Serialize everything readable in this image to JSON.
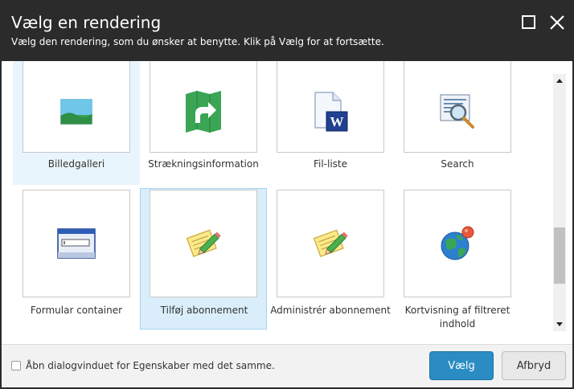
{
  "dialog": {
    "title": "Vælg en rendering",
    "subtitle": "Vælg den rendering, som du ønsker at benytte. Klik på Vælg for at fortsætte.",
    "maximize_icon": "maximize-icon",
    "close_icon": "close-icon"
  },
  "tiles": [
    {
      "label": "Billedgalleri",
      "icon": "image-gallery-icon",
      "state": "hover"
    },
    {
      "label": "Strækningsinformation",
      "icon": "route-sign-icon",
      "state": "normal"
    },
    {
      "label": "Fil-liste",
      "icon": "word-document-icon",
      "state": "normal"
    },
    {
      "label": "Search",
      "icon": "magnifier-document-icon",
      "state": "normal"
    },
    {
      "label": "Formular container",
      "icon": "form-window-icon",
      "state": "normal"
    },
    {
      "label": "Tilføj abonnement",
      "icon": "notepad-pencil-icon",
      "state": "selected"
    },
    {
      "label": "Administrér abonnement",
      "icon": "notepad-pencil-icon",
      "state": "normal"
    },
    {
      "label": "Kortvisning af filtreret indhold",
      "icon": "globe-pin-icon",
      "state": "normal"
    }
  ],
  "footer": {
    "checkbox_label": "Åbn dialogvinduet for Egenskaber med det samme.",
    "checkbox_checked": false,
    "primary_button": "Vælg",
    "secondary_button": "Afbryd"
  },
  "colors": {
    "header_bg": "#2b2b2b",
    "primary": "#2b8cc4",
    "selected_bg": "#d9eefa"
  }
}
